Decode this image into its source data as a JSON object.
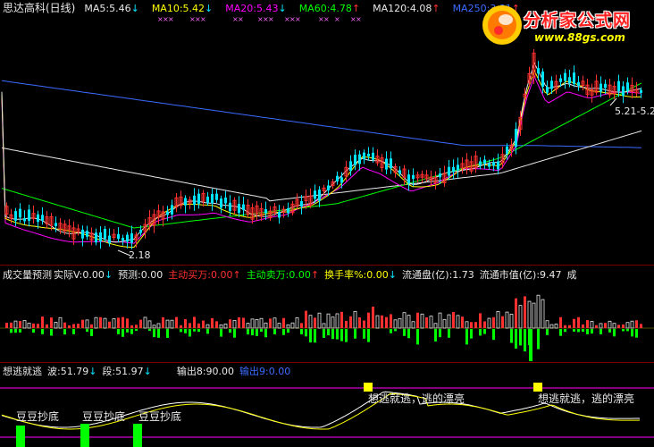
{
  "logo": {
    "title": "分析家公式网",
    "url": "www.88gs.com"
  },
  "main_panel": {
    "title": "思达高科(日线)",
    "ma": [
      {
        "label": "MA5:5.46",
        "arrow": "↓",
        "color": "#e8e8e8"
      },
      {
        "label": "MA10:5.42",
        "arrow": "↓",
        "color": "#ffff00"
      },
      {
        "label": "MA20:5.43",
        "arrow": "↓",
        "color": "#ff00ff"
      },
      {
        "label": "MA60:4.78",
        "arrow": "↑",
        "color": "#00ff00"
      },
      {
        "label": "MA120:4.08",
        "arrow": "↑",
        "color": "#e8e8e8"
      },
      {
        "label": "MA250:3.81",
        "arrow": "↑",
        "color": "#3b6bff"
      }
    ],
    "low_label": "2.18",
    "high_label": "5.21-5.2"
  },
  "volume_panel": {
    "title": "成交量预测",
    "actual_label": "实际V",
    "actual_value": ":0.00",
    "actual_arrow": "↓",
    "forecast_label": "预测:0.00",
    "main_buy_label": "主动买万:0.00",
    "main_buy_arrow": "↑",
    "main_sell_label": "主动卖万:0.00",
    "main_sell_arrow": "↑",
    "turnover_label": "换手率%:0.00",
    "turnover_arrow": "↓",
    "float_label": "流通盘(亿):1.73",
    "float_value_label": "流通市值(亿):9.47",
    "trailing": "成"
  },
  "indicator_panel": {
    "title": "想逃就逃",
    "wave_label": "波:51.79",
    "wave_arrow": "↓",
    "segment_label": "段:51.97",
    "segment_arrow": "↓",
    "output8_label": "输出8:90.00",
    "output9_label": "输出9:0.00",
    "signals": [
      "想逃就逃，逃的漂亮",
      "想逃就逃，逃的漂亮"
    ],
    "bottom_signals": [
      "豆豆抄底",
      "豆豆抄底",
      "豆豆抄底"
    ]
  },
  "colors": {
    "background": "#000000",
    "up": "#ff3030",
    "down": "#00e5ff",
    "ma5": "#e8e8e8",
    "ma10": "#ffff00",
    "ma20": "#ff00ff",
    "ma60": "#00ff00",
    "ma120": "#e8e8e8",
    "ma250": "#3b6bff",
    "separator": "#7a0000"
  }
}
